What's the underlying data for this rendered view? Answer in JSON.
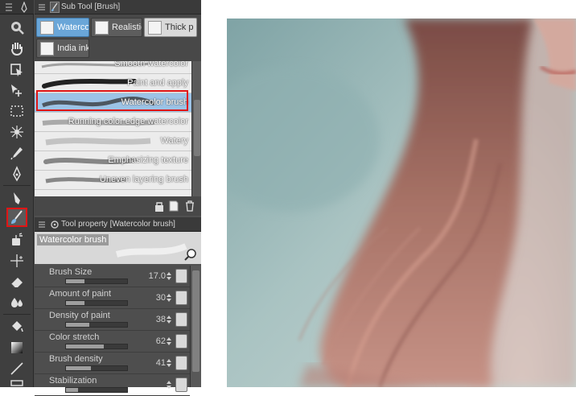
{
  "subtool_panel": {
    "title": "Sub Tool [Brush]",
    "tabs": [
      {
        "label": "Waterco",
        "active": true
      },
      {
        "label": "Realistic",
        "active": false
      },
      {
        "label": "Thick p",
        "active": false
      },
      {
        "label": "India ink",
        "active": false
      }
    ],
    "brushes": [
      {
        "label": "Smooth watercolor"
      },
      {
        "label": "Paint and apply"
      },
      {
        "label": "Watercolor brush",
        "selected": true
      },
      {
        "label": "Running color edge watercolor"
      },
      {
        "label": "Watery"
      },
      {
        "label": "Emphasizing texture"
      },
      {
        "label": "Uneven layering brush"
      }
    ]
  },
  "tool_property_panel": {
    "title": "Tool property [Watercolor brush]",
    "preview_name": "Watercolor brush",
    "properties": [
      {
        "label": "Brush Size",
        "value": "17.0",
        "level": 0.3
      },
      {
        "label": "Amount of paint",
        "value": "30",
        "level": 0.3
      },
      {
        "label": "Density of paint",
        "value": "38",
        "level": 0.38
      },
      {
        "label": "Color stretch",
        "value": "62",
        "level": 0.62
      },
      {
        "label": "Brush density",
        "value": "41",
        "level": 0.41
      },
      {
        "label": "Stabilization",
        "value": "",
        "level": 0.2
      }
    ]
  },
  "tools": [
    "zoom-icon",
    "hand-icon",
    "object-icon",
    "move-layer-icon",
    "selection-icon",
    "auto-select-icon",
    "eyedropper-icon",
    "pen-icon",
    "pencil-icon",
    "brush-icon",
    "airbrush-icon",
    "decoration-icon",
    "eraser-icon",
    "blend-icon",
    "fill-icon",
    "gradient-icon",
    "line-icon"
  ],
  "colors": {
    "highlight": "#e01515",
    "active_tab": "#6aa6d8",
    "selected_row": "#9cc3e6"
  }
}
